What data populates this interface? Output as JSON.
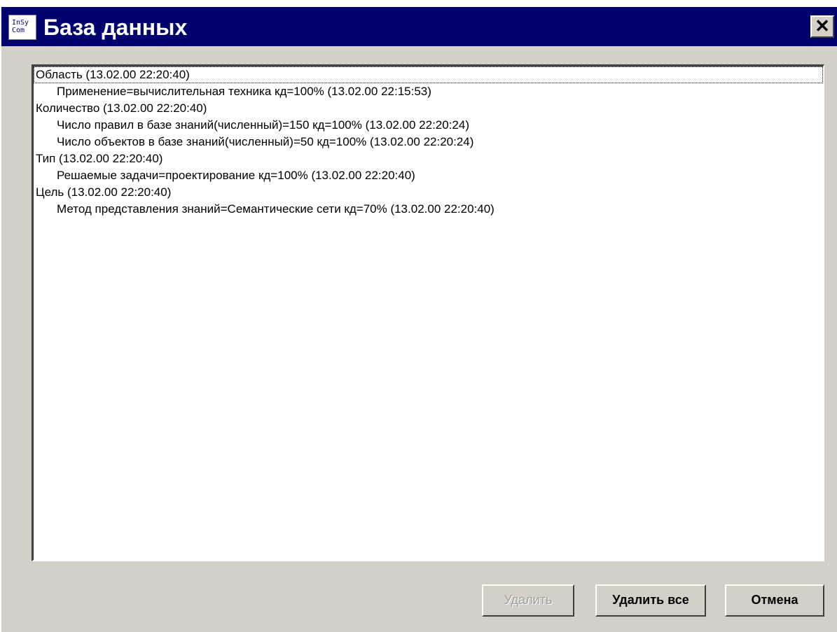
{
  "window": {
    "title": "База данных",
    "icon_text": [
      "InSy",
      "Com"
    ],
    "close_label": "✕"
  },
  "list": {
    "items": [
      {
        "text": "Область   (13.02.00 22:20:40)",
        "level": 0,
        "focused": true
      },
      {
        "text": "Применение=вычислительная техника кд=100% (13.02.00 22:15:53)",
        "level": 1
      },
      {
        "text": "Количество   (13.02.00 22:20:40)",
        "level": 0
      },
      {
        "text": "Число правил в базе знаний(численный)=150 кд=100% (13.02.00 22:20:24)",
        "level": 1
      },
      {
        "text": "Число объектов в базе знаний(численный)=50 кд=100% (13.02.00 22:20:24)",
        "level": 1
      },
      {
        "text": "Тип   (13.02.00 22:20:40)",
        "level": 0
      },
      {
        "text": "Решаемые задачи=проектирование кд=100% (13.02.00 22:20:40)",
        "level": 1
      },
      {
        "text": "Цель   (13.02.00 22:20:40)",
        "level": 0
      },
      {
        "text": "Метод представления знаний=Семантические сети кд=70% (13.02.00 22:20:40)",
        "level": 1
      }
    ]
  },
  "buttons": {
    "delete_label": "Удалить",
    "delete_all_label": "Удалить все",
    "cancel_label": "Отмена"
  },
  "colors": {
    "titlebar": "#00006e",
    "dialog_face": "#d4d0c8",
    "disabled_text": "#a0a0a0"
  }
}
